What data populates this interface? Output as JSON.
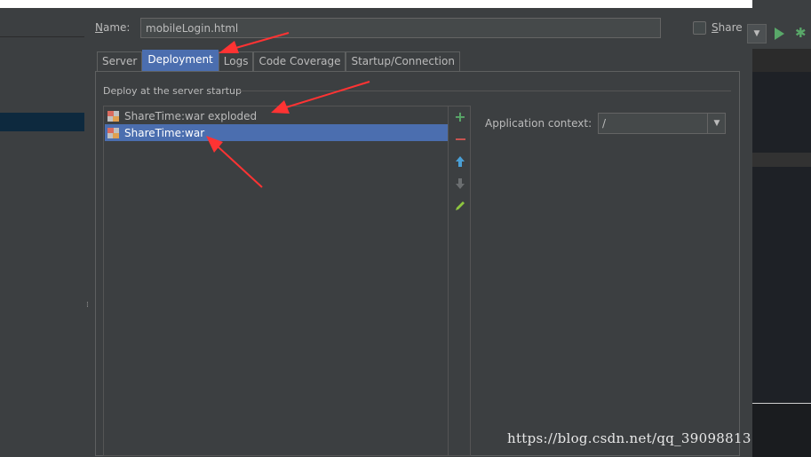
{
  "name_field": {
    "label": "Name:",
    "value": "mobileLogin.html"
  },
  "share": {
    "label": "Share",
    "checked": false
  },
  "tabs": [
    {
      "label": "Server",
      "active": false
    },
    {
      "label": "Deployment",
      "active": true
    },
    {
      "label": "Logs",
      "active": false
    },
    {
      "label": "Code Coverage",
      "active": false
    },
    {
      "label": "Startup/Connection",
      "active": false
    }
  ],
  "deploy_section": {
    "title": "Deploy at the server startup",
    "artifacts": [
      {
        "label": "ShareTime:war exploded",
        "selected": false
      },
      {
        "label": "ShareTime:war",
        "selected": true
      }
    ],
    "toolbar": [
      "add-icon",
      "remove-icon",
      "move-up-icon",
      "move-down-icon",
      "edit-icon"
    ]
  },
  "application_context": {
    "label": "Application context:",
    "value": "/"
  },
  "watermark": "https://blog.csdn.net/qq_39098813",
  "colors": {
    "accent": "#4b6eaf",
    "annotation": "#ff3333",
    "run": "#59a869"
  }
}
